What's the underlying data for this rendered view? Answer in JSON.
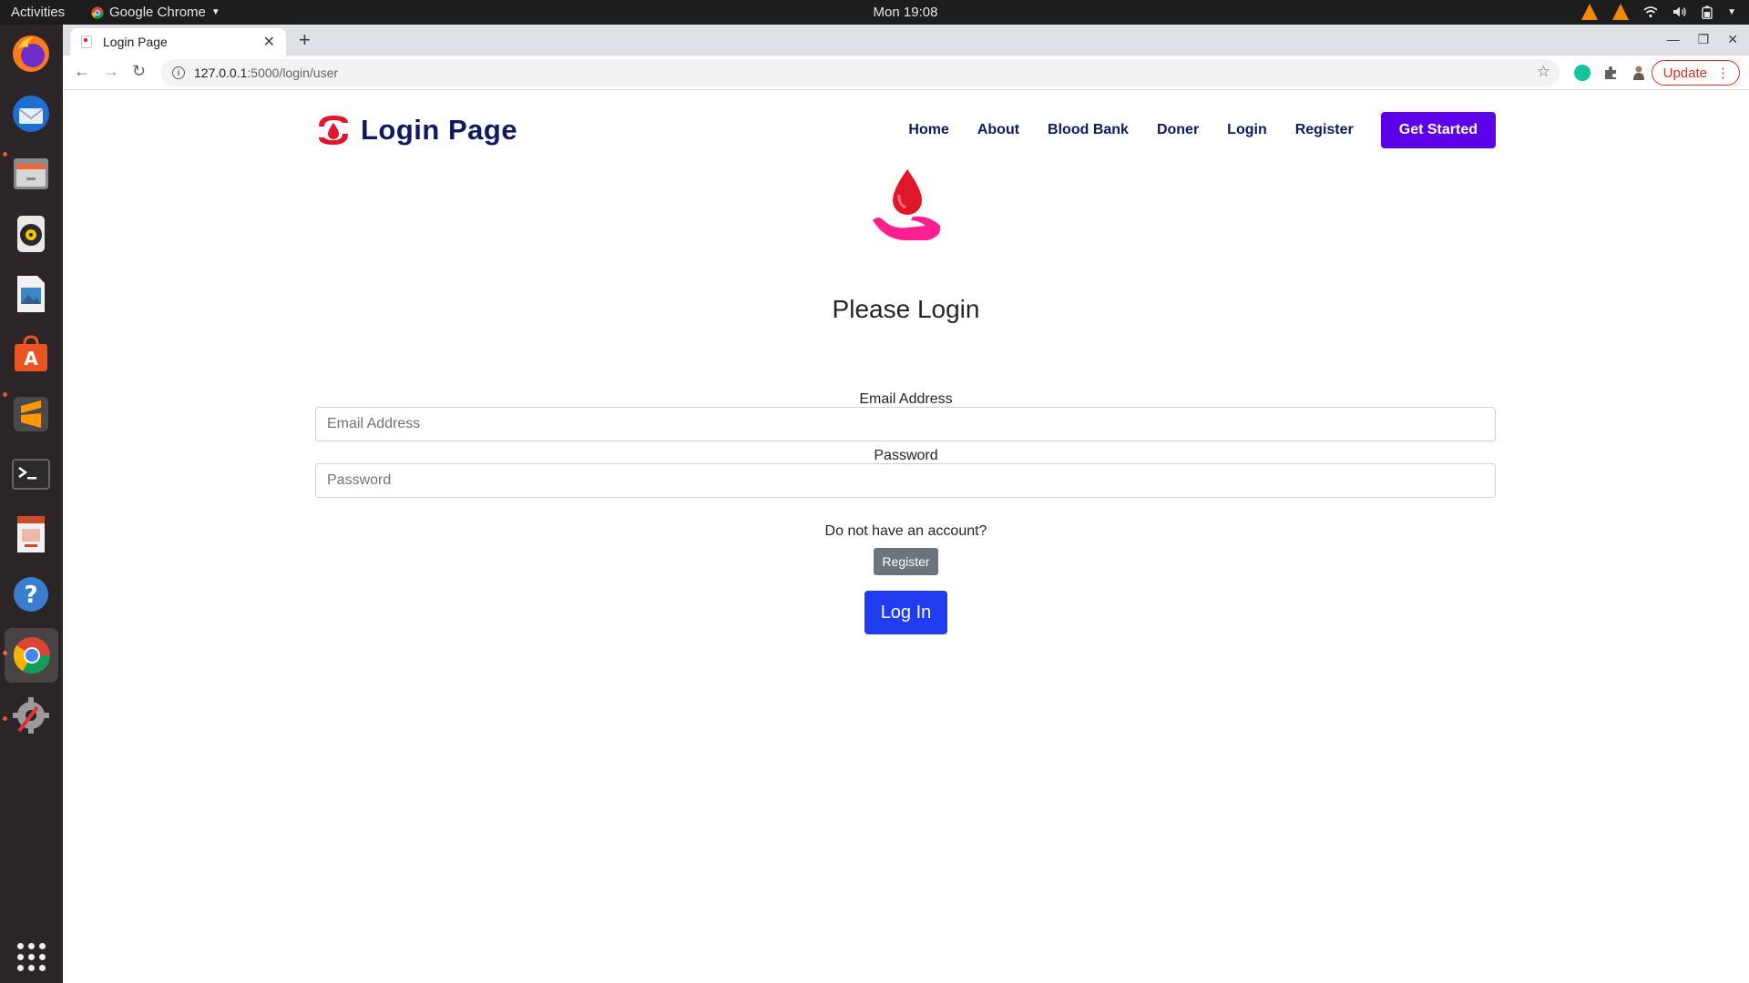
{
  "topbar": {
    "activities": "Activities",
    "app_name": "Google Chrome",
    "clock": "Mon 19:08"
  },
  "dock": {
    "items": [
      "firefox-icon",
      "thunderbird-icon",
      "files-icon",
      "rhythmbox-icon",
      "image-viewer-icon",
      "app-store-icon",
      "sublime-text-icon",
      "terminal-icon",
      "impress-icon",
      "help-icon",
      "chrome-icon",
      "settings-tool-icon"
    ],
    "apps_grid": "show-applications-icon"
  },
  "browser": {
    "tab_title": "Login Page",
    "url_host": "127.0.0.1",
    "url_path": ":5000/login/user",
    "update_label": "Update"
  },
  "site": {
    "brand": "Login Page",
    "nav": {
      "home": "Home",
      "about": "About",
      "blood_bank": "Blood Bank",
      "doner": "Doner",
      "login": "Login",
      "register": "Register",
      "get_started": "Get Started"
    }
  },
  "form": {
    "heading": "Please Login",
    "email_label": "Email Address",
    "email_placeholder": "Email Address",
    "password_label": "Password",
    "password_placeholder": "Password",
    "account_prompt": "Do not have an account?",
    "register_button": "Register",
    "login_button": "Log In"
  },
  "colors": {
    "brand_navy": "#0d1a63",
    "accent_purple": "#5c00e8",
    "login_blue": "#1f3cf0",
    "blood_red": "#e0162b",
    "hand_pink": "#ff1f8e"
  }
}
